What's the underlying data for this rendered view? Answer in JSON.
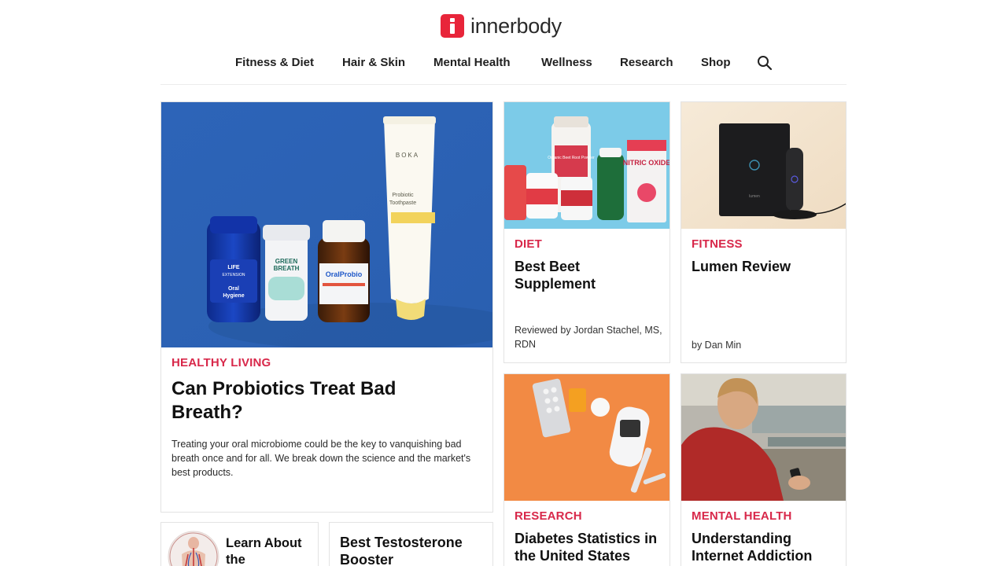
{
  "brand": {
    "name": "innerbody",
    "accent": "#e8253a",
    "category_color": "#d8284a"
  },
  "nav": {
    "items": [
      "Fitness & Diet",
      "Hair & Skin",
      "Mental Health",
      "Wellness",
      "Research",
      "Shop"
    ],
    "search_icon": "search-icon"
  },
  "featured": {
    "category": "HEALTHY LIVING",
    "title": "Can Probiotics Treat Bad Breath?",
    "excerpt": "Treating your oral microbiome could be the key to vanquishing bad breath once and for all. We break down the science and the market's best products.",
    "image_labels": {
      "bottle1_line1": "LIFE",
      "bottle1_line2": "EXTENSION",
      "bottle1_line3": "Oral",
      "bottle1_line4": "Hygiene",
      "bottle2_line1": "GREEN",
      "bottle2_line2": "BREATH",
      "bottle3": "OralProbio",
      "tube_brand": "BOKA",
      "tube_line1": "Probiotic",
      "tube_line2": "Toothpaste"
    }
  },
  "cards": [
    {
      "category": "DIET",
      "title": "Best Beet Supplement",
      "byline": "Reviewed by Jordan Stachel, MS, RDN",
      "image_labels": {
        "can": "NITRIC OXIDE",
        "jar": "Organic Beet Root Powder"
      }
    },
    {
      "category": "FITNESS",
      "title": "Lumen Review",
      "byline": "by Dan Min",
      "image_labels": {
        "box": "lumen"
      }
    },
    {
      "category": "RESEARCH",
      "title": "Diabetes Statistics in the United States",
      "byline": ""
    },
    {
      "category": "MENTAL HEALTH",
      "title": "Understanding Internet Addiction",
      "byline": ""
    }
  ],
  "bottom_cards": [
    {
      "title": "Learn About the"
    },
    {
      "title": "Best Testosterone Booster"
    }
  ]
}
